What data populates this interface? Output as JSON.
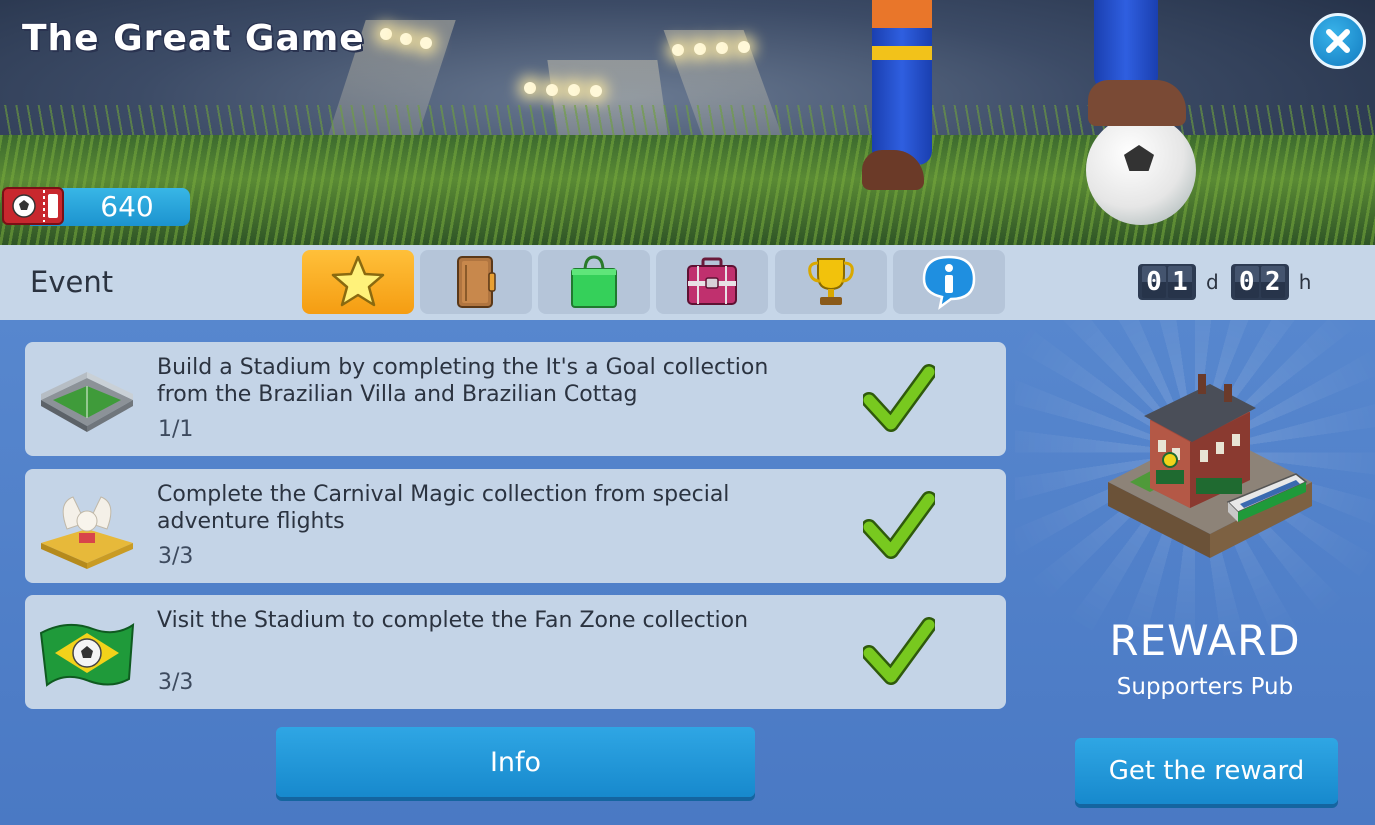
{
  "header": {
    "title": "The Great Game",
    "close_icon": "close-icon",
    "currency": {
      "icon": "ticket-icon",
      "value": "640"
    }
  },
  "tabbar": {
    "label": "Event",
    "tabs": [
      {
        "icon": "star-icon",
        "active": true
      },
      {
        "icon": "notebook-icon",
        "active": false
      },
      {
        "icon": "shopping-bag-icon",
        "active": false
      },
      {
        "icon": "suitcase-icon",
        "active": false
      },
      {
        "icon": "trophy-icon",
        "active": false
      },
      {
        "icon": "info-bubble-icon",
        "active": false
      }
    ],
    "timer": {
      "days_d1": "0",
      "days_d2": "1",
      "days_unit": "d",
      "hours_d1": "0",
      "hours_d2": "2",
      "hours_unit": "h"
    }
  },
  "tasks": [
    {
      "icon": "stadium-icon",
      "text": "Build a Stadium by completing the It's a Goal collection from the Brazilian Villa and Brazilian Cottag",
      "progress": "1/1",
      "status": "checkmark-icon"
    },
    {
      "icon": "carnival-float-icon",
      "text": "Complete the Carnival Magic collection from special adventure flights",
      "progress": "3/3",
      "status": "checkmark-icon"
    },
    {
      "icon": "brazil-flag-icon",
      "text": "Visit the Stadium to complete the Fan Zone collection",
      "progress": "3/3",
      "status": "checkmark-icon"
    }
  ],
  "info_button": "Info",
  "reward": {
    "title": "REWARD",
    "name": "Supporters Pub",
    "button": "Get the reward",
    "image": "supporters-pub-icon"
  },
  "colors": {
    "accent_blue": "#1c93cf",
    "tab_active": "#f5a81a",
    "panel": "#c4d4e7",
    "background": "#4f7fc6",
    "check_green": "#6cbf1c"
  }
}
